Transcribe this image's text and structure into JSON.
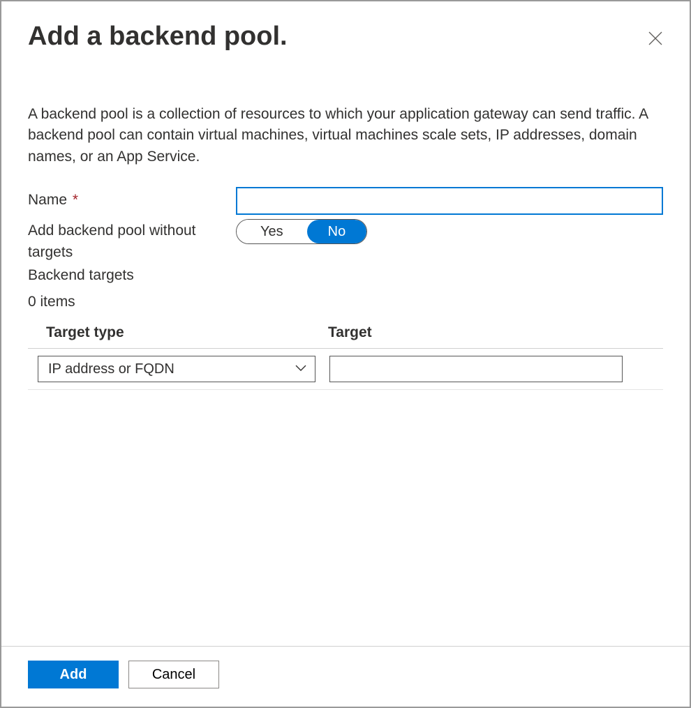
{
  "header": {
    "title": "Add a backend pool."
  },
  "description": "A backend pool is a collection of resources to which your application gateway can send traffic. A backend pool can contain virtual machines, virtual machines scale sets, IP addresses, domain names, or an App Service.",
  "form": {
    "name_label": "Name",
    "name_value": "",
    "no_targets_label": "Add backend pool without targets",
    "toggle_options": {
      "yes": "Yes",
      "no": "No"
    },
    "toggle_selected": "No",
    "backend_targets_label": "Backend targets",
    "items_count": "0 items"
  },
  "table": {
    "header_type": "Target type",
    "header_target": "Target",
    "rows": [
      {
        "type": "IP address or FQDN",
        "target": ""
      }
    ]
  },
  "footer": {
    "add_label": "Add",
    "cancel_label": "Cancel"
  }
}
